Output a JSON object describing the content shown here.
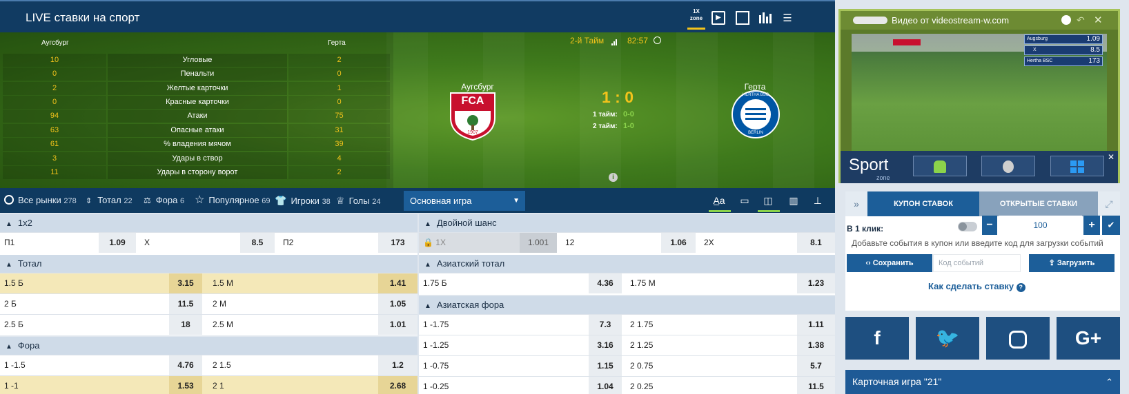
{
  "header": {
    "title": "LIVE ставки на спорт",
    "zone_label": "1X zone"
  },
  "match": {
    "team_home": "Аугсбург",
    "team_away": "Герта",
    "period": "2-й Тайм",
    "time": "82:57",
    "score": "1 : 0",
    "half1_label": "1 тайм:",
    "half1_score": "0-0",
    "half2_label": "2 тайм:",
    "half2_score": "1-0",
    "home_logo_text": "FCA",
    "home_logo_year": "1907",
    "away_logo_top": "HERTHA BSC",
    "away_logo_bottom": "BERLIN",
    "stats": [
      {
        "name": "Угловые",
        "home": "10",
        "away": "2"
      },
      {
        "name": "Пенальти",
        "home": "0",
        "away": "0"
      },
      {
        "name": "Желтые карточки",
        "home": "2",
        "away": "1"
      },
      {
        "name": "Красные карточки",
        "home": "0",
        "away": "0"
      },
      {
        "name": "Атаки",
        "home": "94",
        "away": "75"
      },
      {
        "name": "Опасные атаки",
        "home": "63",
        "away": "31"
      },
      {
        "name": "% владения мячом",
        "home": "61",
        "away": "39"
      },
      {
        "name": "Удары в створ",
        "home": "3",
        "away": "4"
      },
      {
        "name": "Удары в сторону ворот",
        "home": "11",
        "away": "2"
      }
    ]
  },
  "video": {
    "title": "Видео от videostream-w.com",
    "overlay": [
      {
        "label": "Augsburg",
        "value": "1.09"
      },
      {
        "label": "X",
        "value": "8.5"
      },
      {
        "label": "Hertha BSC",
        "value": "173"
      }
    ],
    "brand": "Sport",
    "brand_sub": "zone"
  },
  "tabs": [
    {
      "label": "Все рынки",
      "count": "278"
    },
    {
      "label": "Тотал",
      "count": "22"
    },
    {
      "label": "Фора",
      "count": "6"
    },
    {
      "label": "Популярное",
      "count": "69"
    },
    {
      "label": "Игроки",
      "count": "38"
    },
    {
      "label": "Голы",
      "count": "24"
    }
  ],
  "game_select": "Основная игра",
  "markets_left": {
    "m1x2": {
      "title": "1x2",
      "p1": "П1",
      "p1v": "1.09",
      "x": "X",
      "xv": "8.5",
      "p2": "П2",
      "p2v": "173"
    },
    "total": {
      "title": "Тотал",
      "rows": [
        {
          "a": "1.5 Б",
          "av": "3.15",
          "b": "1.5 М",
          "bv": "1.41"
        },
        {
          "a": "2 Б",
          "av": "11.5",
          "b": "2 М",
          "bv": "1.05"
        },
        {
          "a": "2.5 Б",
          "av": "18",
          "b": "2.5 М",
          "bv": "1.01"
        }
      ]
    },
    "fora": {
      "title": "Фора",
      "rows": [
        {
          "a": "1 -1.5",
          "av": "4.76",
          "b": "2 1.5",
          "bv": "1.2"
        },
        {
          "a": "1 -1",
          "av": "1.53",
          "b": "2 1",
          "bv": "2.68"
        }
      ]
    }
  },
  "markets_right": {
    "double": {
      "title": "Двойной шанс",
      "a": "1X",
      "av": "1.001",
      "b": "12",
      "bv": "1.06",
      "c": "2X",
      "cv": "8.1"
    },
    "asian_total": {
      "title": "Азиатский тотал",
      "rows": [
        {
          "a": "1.75 Б",
          "av": "4.36",
          "b": "1.75 М",
          "bv": "1.23"
        }
      ]
    },
    "asian_fora": {
      "title": "Азиатская фора",
      "rows": [
        {
          "a": "1 -1.75",
          "av": "7.3",
          "b": "2 1.75",
          "bv": "1.11"
        },
        {
          "a": "1 -1.25",
          "av": "3.16",
          "b": "2 1.25",
          "bv": "1.38"
        },
        {
          "a": "1 -0.75",
          "av": "1.15",
          "b": "2 0.75",
          "bv": "5.7"
        },
        {
          "a": "1 -0.25",
          "av": "1.04",
          "b": "2 0.25",
          "bv": "11.5"
        }
      ]
    }
  },
  "coupon": {
    "tab_active": "КУПОН СТАВОК",
    "tab_other": "ОТКРЫТЫЕ СТАВКИ",
    "one_click_label": "В 1 клик:",
    "amount": "100",
    "hint": "Добавьте события в купон или введите код для загрузки событий",
    "save_label": "Сохранить",
    "code_placeholder": "Код событий",
    "load_label": "Загрузить",
    "howto": "Как сделать ставку"
  },
  "card_game": "Карточная игра \"21\"",
  "colors": {
    "navy": "#113b62",
    "accent_blue": "#1c5e99",
    "yellow": "#f3c31b",
    "green_score": "#8bd34b"
  }
}
